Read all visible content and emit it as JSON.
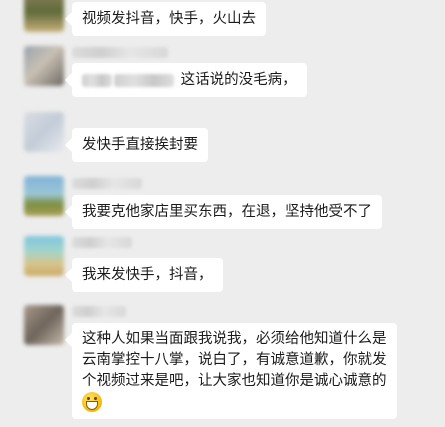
{
  "messages": [
    {
      "text": "视频发抖音，快手，火山去"
    },
    {
      "text": "这话说的没毛病，",
      "quoted": true
    },
    {
      "text": "发快手直接挨封要"
    },
    {
      "text": "我要克他家店里买东西，在退，坚持他受不了"
    },
    {
      "text": "我来发快手，抖音，"
    },
    {
      "lines": [
        "这种人如果当面跟我说我，必须给他知道什么是",
        "云南掌控十八掌，说白了，有诚意道歉，你就发",
        "个视频过来是吧，让大家也知道你是诚心诚意的"
      ],
      "emoji": "grin-emoji"
    }
  ],
  "colors": {
    "background": "#ededed",
    "bubble": "#ffffff",
    "text": "#1a1a1a"
  }
}
